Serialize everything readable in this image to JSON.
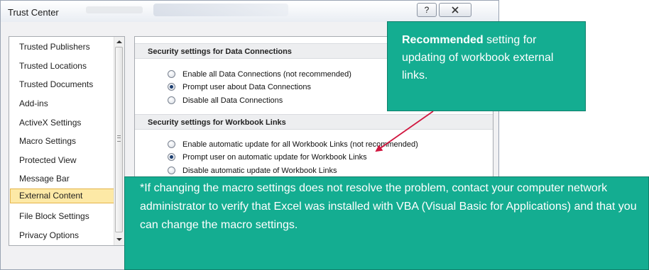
{
  "window": {
    "title": "Trust Center",
    "help_glyph": "?",
    "close_glyph": "x"
  },
  "sidebar": {
    "items": [
      {
        "label": "Trusted Publishers"
      },
      {
        "label": "Trusted Locations"
      },
      {
        "label": "Trusted Documents"
      },
      {
        "label": "Add-ins"
      },
      {
        "label": "ActiveX Settings"
      },
      {
        "label": "Macro Settings"
      },
      {
        "label": "Protected View"
      },
      {
        "label": "Message Bar"
      },
      {
        "label": "External Content"
      },
      {
        "label": "File Block Settings"
      },
      {
        "label": "Privacy Options"
      }
    ],
    "selected": "External Content"
  },
  "data_connections": {
    "header": "Security settings for Data Connections",
    "options": [
      {
        "label": "Enable all Data Connections (not recommended)",
        "checked": false
      },
      {
        "label": "Prompt user about Data Connections",
        "checked": true
      },
      {
        "label": "Disable all Data Connections",
        "checked": false
      }
    ]
  },
  "workbook_links": {
    "header": "Security settings for Workbook Links",
    "options": [
      {
        "label": "Enable automatic update for all Workbook Links (not recommended)",
        "checked": false
      },
      {
        "label": "Prompt user on automatic update for Workbook Links",
        "checked": true
      },
      {
        "label": "Disable automatic update of Workbook Links",
        "checked": false
      }
    ]
  },
  "callout": {
    "bold": "Recommended",
    "rest": " setting for updating of workbook external links."
  },
  "note": {
    "text": "*If changing the macro settings does not resolve the problem, contact your computer network administrator to verify that Excel was installed with VBA (Visual Basic for Applications) and that you can change the macro settings."
  },
  "colors": {
    "callout_bg": "#14ad91",
    "selected_item_bg": "#fde9a6",
    "arrow": "#d1163f"
  }
}
